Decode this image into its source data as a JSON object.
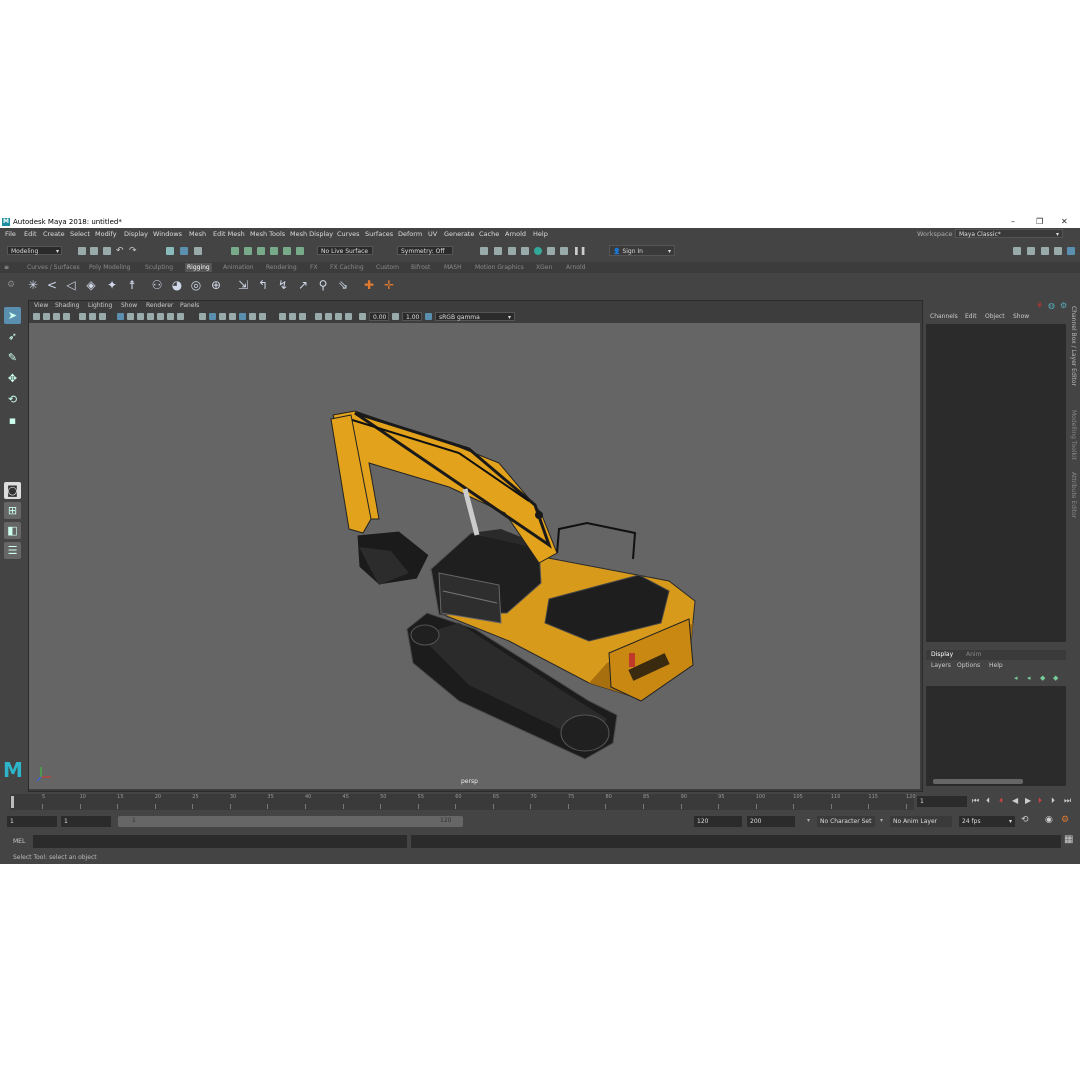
{
  "window": {
    "title": "Autodesk Maya 2018: untitled*",
    "logo": "M"
  },
  "menus": [
    "File",
    "Edit",
    "Create",
    "Select",
    "Modify",
    "Display",
    "Windows",
    "Mesh",
    "Edit Mesh",
    "Mesh Tools",
    "Mesh Display",
    "Curves",
    "Surfaces",
    "Deform",
    "UV",
    "Generate",
    "Cache",
    "Arnold",
    "Help"
  ],
  "workspace": {
    "label": "Workspace :",
    "value": "Maya Classic*"
  },
  "toolbar": {
    "menuset": "Modeling",
    "live_surface": "No Live Surface",
    "symmetry": "Symmetry: Off",
    "sign_in": "Sign In"
  },
  "shelf_tabs": [
    "Curves / Surfaces",
    "Poly Modeling",
    "Sculpting",
    "Rigging",
    "Animation",
    "Rendering",
    "FX",
    "FX Caching",
    "Custom",
    "Bifrost",
    "MASH",
    "Motion Graphics",
    "XGen",
    "Arnold"
  ],
  "active_shelf_tab": "Rigging",
  "viewport": {
    "menus": [
      "View",
      "Shading",
      "Lighting",
      "Show",
      "Renderer",
      "Panels"
    ],
    "exposure": "0.00",
    "gamma": "1.00",
    "colorspace": "sRGB gamma",
    "camera_label": "persp"
  },
  "channel_box": {
    "menus": [
      "Channels",
      "Edit",
      "Object",
      "Show"
    ],
    "side_tabs": [
      "Channel Box / Layer Editor",
      "Modelling Toolkit",
      "Attribute Editor"
    ]
  },
  "layer_editor": {
    "tabs": [
      "Display",
      "Anim"
    ],
    "menus": [
      "Layers",
      "Options",
      "Help"
    ]
  },
  "timeline": {
    "ticks": [
      "5",
      "10",
      "15",
      "20",
      "25",
      "30",
      "35",
      "40",
      "45",
      "50",
      "55",
      "60",
      "65",
      "70",
      "75",
      "80",
      "85",
      "90",
      "95",
      "100",
      "105",
      "110",
      "115",
      "120"
    ],
    "current_frame": "1"
  },
  "range": {
    "start": "1",
    "playback_start": "1",
    "slider_start": "1",
    "slider_end": "120",
    "playback_end": "120",
    "end": "200",
    "character_set": "No Character Set",
    "anim_layer": "No Anim Layer",
    "fps": "24 fps"
  },
  "command": {
    "mel_label": "MEL",
    "help_line": "Select Tool: select an object"
  },
  "colors": {
    "accent": "#1b8fa0",
    "excavator_yellow": "#e8a21a",
    "viewport_bg": "#656565"
  }
}
